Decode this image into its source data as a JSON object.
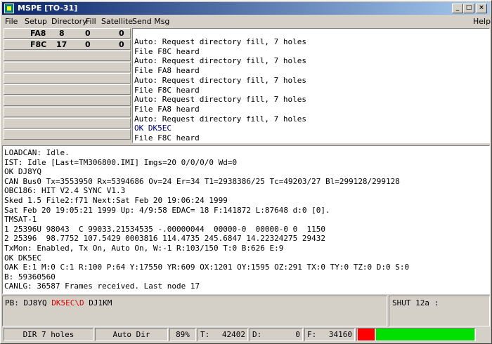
{
  "window": {
    "title": "MSPE [TO-31]"
  },
  "menu": {
    "file": "File",
    "setup": "Setup",
    "directory": "Directory",
    "fill": "Fill",
    "satellite": "Satellite",
    "send_msg": "Send Msg",
    "help": "Help"
  },
  "file_table": [
    {
      "name": "FA8",
      "a": "8",
      "b": "0",
      "c": "0"
    },
    {
      "name": "F8C",
      "a": "17",
      "b": "0",
      "c": "0"
    }
  ],
  "top_log": [
    "Auto: Request directory fill, 7 holes",
    "File F8C heard",
    "Auto: Request directory fill, 7 holes",
    "File FA8 heard",
    "Auto: Request directory fill, 7 holes",
    "File F8C heard",
    "Auto: Request directory fill, 7 holes",
    "File FA8 heard",
    "Auto: Request directory fill, 7 holes",
    "OK DK5EC",
    "File F8C heard"
  ],
  "main_log": [
    "LOADCAN: Idle.",
    "IST: Idle [Last=TM306800.IMI] Imgs=20 0/0/0/0 Wd=0",
    "OK DJ8YQ",
    "CAN Bus0 Tx=3553950 Rx=5394686 Ov=24 Er=34 T1=2938386/25 Tc=49203/27 Bl=299128/299128",
    "OBC186: HIT V2.4 SYNC V1.3",
    "Sked 1.5 File2:f71 Next:Sat Feb 20 19:06:24 1999",
    "Sat Feb 20 19:05:21 1999 Up: 4/9:58 EDAC= 18 F:141872 L:87648 d:0 [0].",
    "TMSAT-1",
    "1 25396U 98043  C 99033.21534535 -.00000044  00000-0  00000-0 0  1150",
    "2 25396  98.7752 107.5429 0003816 114.4735 245.6847 14.22324275 29432",
    "TxMon: Enabled, Tx On, Auto On, W:-1 R:103/150 T:0 B:626 E:9",
    "OK DK5EC",
    "OAK E:1 M:0 C:1 R:100 P:64 Y:17550 YR:609 OX:1201 OY:1595 OZ:291 TX:0 TY:0 TZ:0 D:0 S:0",
    "B: 59360560",
    "CANLG: 36587 Frames received. Last node 17"
  ],
  "pb": {
    "prefix": "PB: DJ8YQ ",
    "highlight": "DK5EC\\D",
    "suffix": " DJ1KM"
  },
  "shut": "SHUT 12a :",
  "status": {
    "dir_holes": "DIR 7 holes",
    "auto_dir": "Auto Dir",
    "percent": "89%",
    "t_label": "T:",
    "t_value": "42402",
    "d_label": "D:",
    "d_value": "0",
    "f_label": "F:",
    "f_value": "34160"
  },
  "progress": {
    "red_fraction": 0.14,
    "green_fraction": 0.82
  },
  "colors": {
    "titlebar": "#0a246a",
    "highlight_red": "#e00000",
    "progress_red": "#ff0000",
    "progress_green": "#00e000"
  }
}
